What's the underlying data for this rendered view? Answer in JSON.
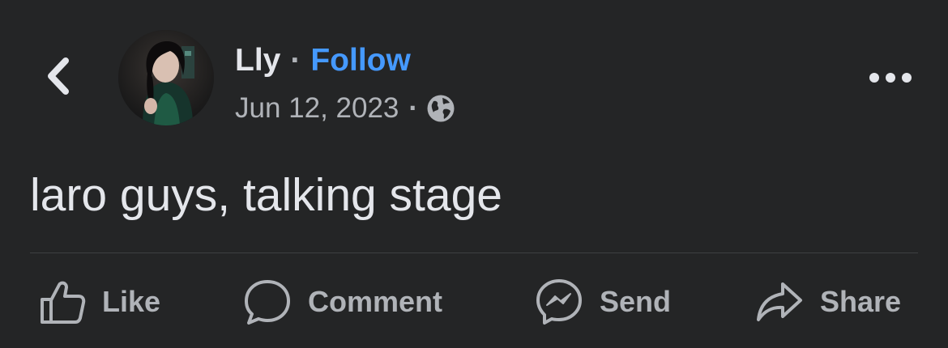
{
  "header": {
    "back_icon": "chevron-left-icon",
    "author": {
      "name": "Lly",
      "separator": "·",
      "follow_label": "Follow"
    },
    "meta": {
      "date": "Jun 12, 2023",
      "separator": "·",
      "privacy_icon": "globe-icon"
    },
    "more_icon": "more-horizontal-icon"
  },
  "post": {
    "text": "laro guys, talking stage"
  },
  "actions": [
    {
      "label": "Like",
      "icon": "thumbs-up-icon"
    },
    {
      "label": "Comment",
      "icon": "comment-bubble-icon"
    },
    {
      "label": "Send",
      "icon": "messenger-icon"
    },
    {
      "label": "Share",
      "icon": "share-arrow-icon"
    }
  ],
  "colors": {
    "background": "#242526",
    "text_primary": "#e4e6eb",
    "text_secondary": "#b0b3b8",
    "link": "#4599ff",
    "divider": "#3e4042"
  }
}
